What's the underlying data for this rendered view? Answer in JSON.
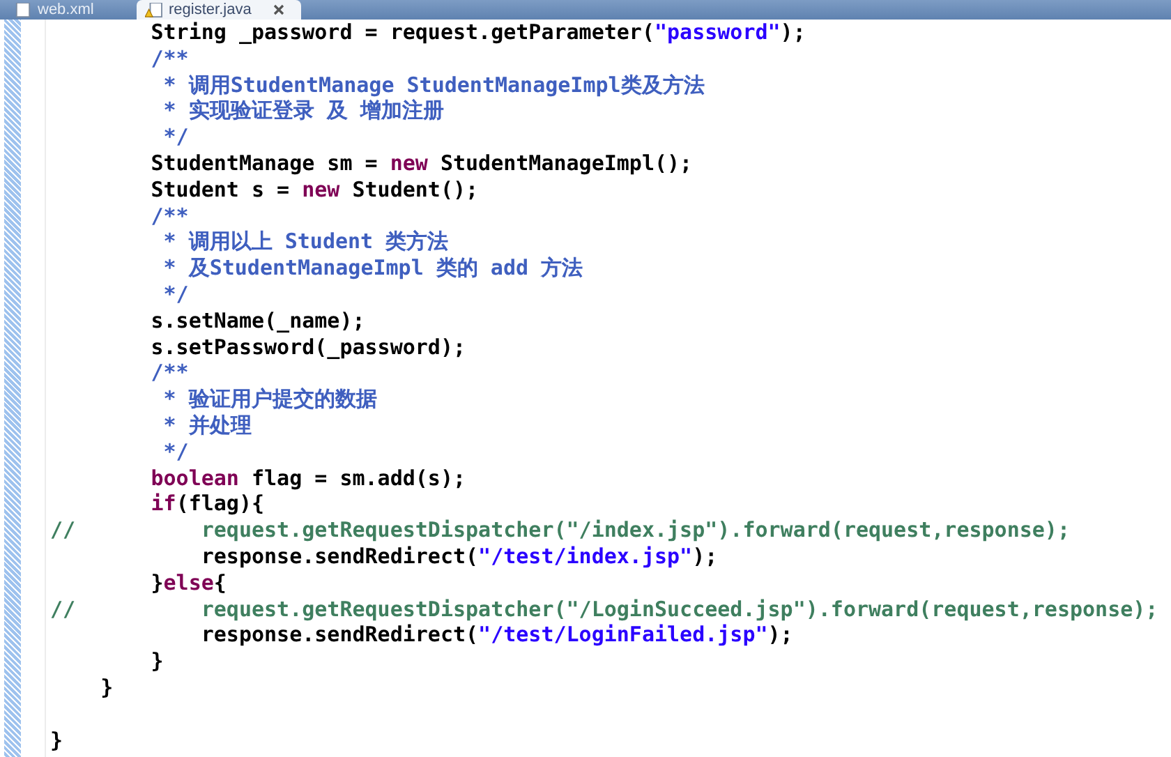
{
  "tabs": [
    {
      "label": "web.xml",
      "selected": false
    },
    {
      "label": "register.java",
      "selected": true
    }
  ],
  "editor": {
    "lines": [
      {
        "kind": "code",
        "tokens": [
          {
            "kind": "plain",
            "text": "        String _password = request.getParameter("
          },
          {
            "kind": "string",
            "text": "\"password\""
          },
          {
            "kind": "plain",
            "text": ");"
          }
        ]
      },
      {
        "kind": "code",
        "tokens": [
          {
            "kind": "javadoc",
            "text": "        /**"
          }
        ]
      },
      {
        "kind": "code",
        "tokens": [
          {
            "kind": "javadoc",
            "text": "         * 调用StudentManage StudentManageImpl类及方法"
          }
        ]
      },
      {
        "kind": "code",
        "tokens": [
          {
            "kind": "javadoc",
            "text": "         * 实现验证登录 及 增加注册"
          }
        ]
      },
      {
        "kind": "code",
        "tokens": [
          {
            "kind": "javadoc",
            "text": "         */"
          }
        ]
      },
      {
        "kind": "code",
        "tokens": [
          {
            "kind": "plain",
            "text": "        StudentManage sm = "
          },
          {
            "kind": "keyword",
            "text": "new"
          },
          {
            "kind": "plain",
            "text": " StudentManageImpl();"
          }
        ]
      },
      {
        "kind": "code",
        "tokens": [
          {
            "kind": "plain",
            "text": "        Student s = "
          },
          {
            "kind": "keyword",
            "text": "new"
          },
          {
            "kind": "plain",
            "text": " Student();"
          }
        ]
      },
      {
        "kind": "code",
        "tokens": [
          {
            "kind": "javadoc",
            "text": "        /**"
          }
        ]
      },
      {
        "kind": "code",
        "tokens": [
          {
            "kind": "javadoc",
            "text": "         * 调用以上 Student 类方法"
          }
        ]
      },
      {
        "kind": "code",
        "tokens": [
          {
            "kind": "javadoc",
            "text": "         * 及StudentManageImpl 类的 add 方法"
          }
        ]
      },
      {
        "kind": "code",
        "tokens": [
          {
            "kind": "javadoc",
            "text": "         */"
          }
        ]
      },
      {
        "kind": "code",
        "tokens": [
          {
            "kind": "plain",
            "text": "        s.setName(_name);"
          }
        ]
      },
      {
        "kind": "code",
        "tokens": [
          {
            "kind": "plain",
            "text": "        s.setPassword(_password);"
          }
        ]
      },
      {
        "kind": "code",
        "tokens": [
          {
            "kind": "javadoc",
            "text": "        /**"
          }
        ]
      },
      {
        "kind": "code",
        "tokens": [
          {
            "kind": "javadoc",
            "text": "         * 验证用户提交的数据"
          }
        ]
      },
      {
        "kind": "code",
        "tokens": [
          {
            "kind": "javadoc",
            "text": "         * 并处理"
          }
        ]
      },
      {
        "kind": "code",
        "tokens": [
          {
            "kind": "javadoc",
            "text": "         */"
          }
        ]
      },
      {
        "kind": "code",
        "tokens": [
          {
            "kind": "keyword",
            "text": "        boolean"
          },
          {
            "kind": "plain",
            "text": " flag = sm.add(s);"
          }
        ]
      },
      {
        "kind": "code",
        "tokens": [
          {
            "kind": "keyword",
            "text": "        if"
          },
          {
            "kind": "plain",
            "text": "(flag){"
          }
        ]
      },
      {
        "kind": "code",
        "tokens": [
          {
            "kind": "comment",
            "text": "//          request.getRequestDispatcher(\"/index.jsp\").forward(request,response);"
          }
        ]
      },
      {
        "kind": "code",
        "tokens": [
          {
            "kind": "plain",
            "text": "            response.sendRedirect("
          },
          {
            "kind": "string",
            "text": "\"/test/index.jsp\""
          },
          {
            "kind": "plain",
            "text": ");"
          }
        ]
      },
      {
        "kind": "code",
        "tokens": [
          {
            "kind": "plain",
            "text": "        }"
          },
          {
            "kind": "keyword",
            "text": "else"
          },
          {
            "kind": "plain",
            "text": "{"
          }
        ]
      },
      {
        "kind": "code",
        "tokens": [
          {
            "kind": "comment",
            "text": "//          request.getRequestDispatcher(\"/LoginSucceed.jsp\").forward(request,response);"
          }
        ]
      },
      {
        "kind": "code",
        "tokens": [
          {
            "kind": "plain",
            "text": "            response.sendRedirect("
          },
          {
            "kind": "string",
            "text": "\"/test/LoginFailed.jsp\""
          },
          {
            "kind": "plain",
            "text": ");"
          }
        ]
      },
      {
        "kind": "code",
        "tokens": [
          {
            "kind": "plain",
            "text": "        }"
          }
        ]
      },
      {
        "kind": "code",
        "tokens": [
          {
            "kind": "plain",
            "text": "    }"
          }
        ]
      },
      {
        "kind": "blank"
      },
      {
        "kind": "code",
        "tokens": [
          {
            "kind": "plain",
            "text": "}"
          }
        ]
      }
    ]
  }
}
